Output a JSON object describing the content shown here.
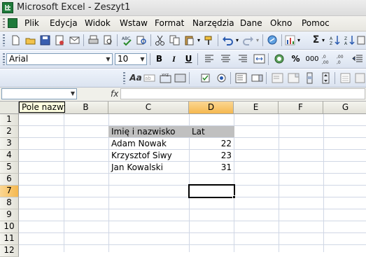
{
  "window": {
    "title": "Microsoft Excel - Zeszyt1"
  },
  "menu": [
    "Plik",
    "Edycja",
    "Widok",
    "Wstaw",
    "Format",
    "Narzędzia",
    "Dane",
    "Okno",
    "Pomoc"
  ],
  "formatting": {
    "font": "Arial",
    "size": "10",
    "bold": "B",
    "italic": "I",
    "underline": "U",
    "percent": "%",
    "thousands": "000"
  },
  "toolbar3": {
    "aa": "Aa"
  },
  "formula_bar": {
    "name_box": "",
    "fx": "fx",
    "content": ""
  },
  "tooltip": "Pole nazwy",
  "grid": {
    "columns": [
      "A",
      "B",
      "C",
      "D",
      "E",
      "F",
      "G"
    ],
    "rows": [
      "1",
      "2",
      "3",
      "4",
      "5",
      "6",
      "7",
      "8",
      "9",
      "10",
      "11",
      "12"
    ],
    "active_cell": "D7",
    "cells": {
      "C2": "Imię i nazwisko",
      "D2": "Lat",
      "C3": "Adam Nowak",
      "D3": "22",
      "C4": "Krzysztof Siwy",
      "D4": "23",
      "C5": "Jan Kowalski",
      "D5": "31"
    }
  }
}
